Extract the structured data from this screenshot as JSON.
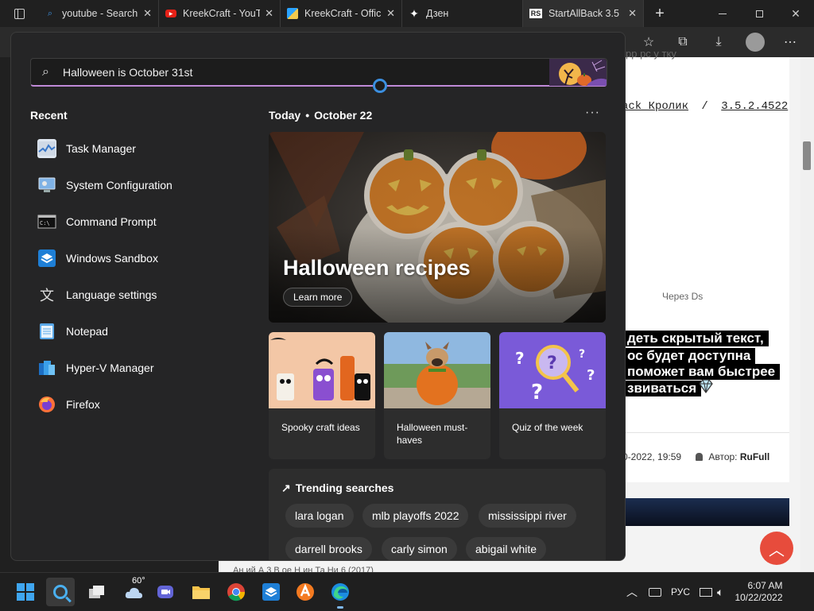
{
  "browser": {
    "tabs": [
      {
        "title": "youtube - Search",
        "icon": "search-icon"
      },
      {
        "title": "KreekCraft - YouTube",
        "icon": "youtube-icon"
      },
      {
        "title": "KreekCraft - Official",
        "icon": "kreekcraft-icon"
      },
      {
        "title": "Дзен",
        "icon": "zen-icon"
      },
      {
        "title": "StartAllBack 3.5",
        "icon": "rs-icon"
      }
    ],
    "new_tab_symbol": "+",
    "page": {
      "link_user": "ack_Кролик",
      "link_sep": "/",
      "link_version": "3.5.2.4522",
      "top_text": "рр рс у тку",
      "via": "Через Ds",
      "ru_line1": "деть скрытый текст,",
      "ru_line2": "ос будет доступна",
      "ru_line3": "поможет вам быстрее",
      "ru_line4": "звиваться",
      "date_partial": "0-2022, 19:59",
      "author_label": "Автор:",
      "author_name": "RuFull",
      "bottom_text": "Ан    ий А  3   В    ое     Н  ин  Та  Ни  6 (2017)"
    }
  },
  "start": {
    "search": {
      "value": "",
      "placeholder": "Halloween is October 31st"
    },
    "recent_heading": "Recent",
    "recent": [
      {
        "label": "Task Manager",
        "icon": "task-manager-icon"
      },
      {
        "label": "System Configuration",
        "icon": "system-configuration-icon"
      },
      {
        "label": "Command Prompt",
        "icon": "command-prompt-icon"
      },
      {
        "label": "Windows Sandbox",
        "icon": "windows-sandbox-icon"
      },
      {
        "label": "Language settings",
        "icon": "language-settings-icon"
      },
      {
        "label": "Notepad",
        "icon": "notepad-icon"
      },
      {
        "label": "Hyper-V Manager",
        "icon": "hyper-v-icon"
      },
      {
        "label": "Firefox",
        "icon": "firefox-icon"
      }
    ],
    "today_label": "Today",
    "today_date": "October 22",
    "more_label": "···",
    "hero": {
      "title": "Halloween recipes",
      "button": "Learn more"
    },
    "cards": [
      {
        "caption": "Spooky craft ideas"
      },
      {
        "caption": "Halloween must-haves"
      },
      {
        "caption": "Quiz of the week"
      }
    ],
    "trending_heading": "Trending searches",
    "trending": [
      "lara logan",
      "mlb playoffs 2022",
      "mississippi river",
      "darrell brooks",
      "carly simon",
      "abigail white"
    ]
  },
  "taskbar": {
    "weather_temp": "60°",
    "lang": "РУС",
    "time": "6:07 AM",
    "date": "10/22/2022"
  },
  "colors": {
    "panel_bg": "#252526",
    "card_bg": "#2d2d2d",
    "accent_underline": "#c08ad8",
    "fab": "#e74c3c"
  }
}
